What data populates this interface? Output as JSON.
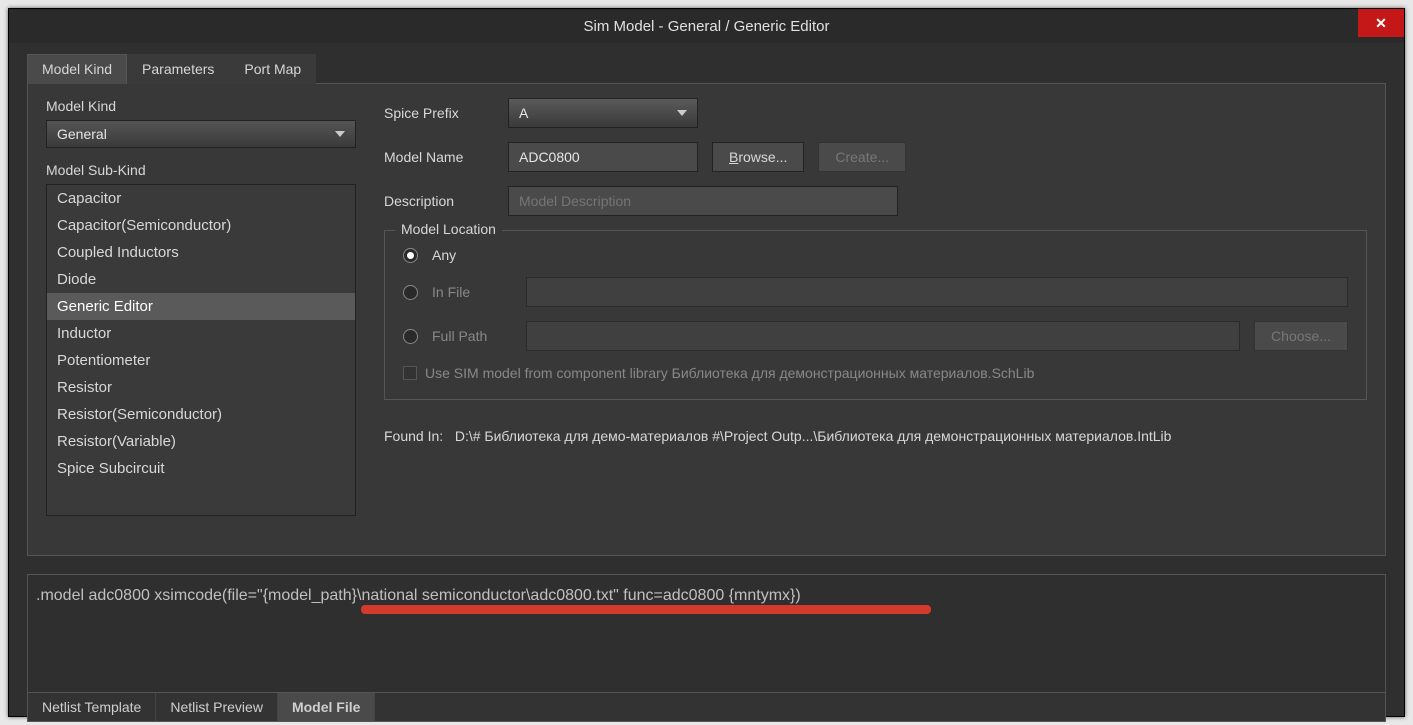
{
  "window": {
    "title": "Sim Model - General / Generic Editor"
  },
  "tabs": {
    "top": [
      "Model Kind",
      "Parameters",
      "Port Map"
    ],
    "top_active": 0,
    "bottom": [
      "Netlist Template",
      "Netlist Preview",
      "Model File"
    ],
    "bottom_active": 2
  },
  "left": {
    "model_kind_label": "Model Kind",
    "model_kind_value": "General",
    "sub_kind_label": "Model Sub-Kind",
    "sub_kind_items": [
      "Capacitor",
      "Capacitor(Semiconductor)",
      "Coupled Inductors",
      "Diode",
      "Generic Editor",
      "Inductor",
      "Potentiometer",
      "Resistor",
      "Resistor(Semiconductor)",
      "Resistor(Variable)",
      "Spice Subcircuit"
    ],
    "sub_kind_selected": 4
  },
  "right": {
    "spice_prefix_label": "Spice Prefix",
    "spice_prefix_value": "A",
    "model_name_label": "Model Name",
    "model_name_value": "ADC0800",
    "browse_label": "Browse...",
    "create_label": "Create...",
    "description_label": "Description",
    "description_placeholder": "Model Description",
    "location": {
      "legend": "Model Location",
      "any": "Any",
      "in_file": "In File",
      "full_path": "Full Path",
      "choose": "Choose...",
      "use_sim_label": "Use SIM model from component library Библиотека для демонстрационных материалов.SchLib",
      "selected": "any"
    },
    "found_in_label": "Found In:",
    "found_in_value": "D:\\# Библиотека для демо-материалов #\\Project Outp...\\Библиотека для демонстрационных материалов.IntLib"
  },
  "code": {
    "text": ".model adc0800 xsimcode(file=\"{model_path}\\national semiconductor\\adc0800.txt\" func=adc0800 {mntymx})"
  }
}
